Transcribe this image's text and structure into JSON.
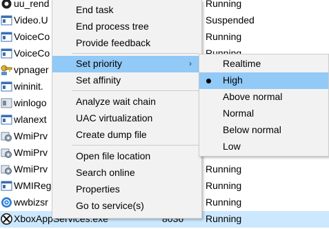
{
  "processes": [
    {
      "name": "uu_rend",
      "pid": "",
      "status": "Running",
      "icon": "app-window-icon"
    },
    {
      "name": "Video.U",
      "pid": "",
      "status": "Suspended",
      "icon": "app-window-icon"
    },
    {
      "name": "VoiceCo",
      "pid": "",
      "status": "Running",
      "icon": "app-window-icon"
    },
    {
      "name": "VoiceCo",
      "pid": "",
      "status": "Running",
      "icon": "app-window-icon"
    },
    {
      "name": "vpnager",
      "pid": "",
      "status": "",
      "icon": "key-icon"
    },
    {
      "name": "wininit.",
      "pid": "",
      "status": "",
      "icon": "app-window-icon"
    },
    {
      "name": "winlogo",
      "pid": "",
      "status": "",
      "icon": "app-window-icon"
    },
    {
      "name": "wlanext",
      "pid": "",
      "status": "",
      "icon": "app-window-icon"
    },
    {
      "name": "WmiPrv",
      "pid": "",
      "status": "",
      "icon": "gear-icon"
    },
    {
      "name": "WmiPrv",
      "pid": "",
      "status": "",
      "icon": "gear-icon"
    },
    {
      "name": "WmiPrv",
      "pid": "",
      "status": "Running",
      "icon": "gear-icon"
    },
    {
      "name": "WMIReg",
      "pid": "",
      "status": "Running",
      "icon": "app-window-icon"
    },
    {
      "name": "wwbizsr",
      "pid": "",
      "status": "Running",
      "icon": "globe-icon"
    },
    {
      "name": "XboxAppServices.exe",
      "pid": "8036",
      "status": "Running",
      "icon": "xbox-icon"
    }
  ],
  "context_menu": {
    "items": [
      {
        "label": "End task"
      },
      {
        "label": "End process tree"
      },
      {
        "label": "Provide feedback"
      },
      {
        "label": "Set priority",
        "submenu": true
      },
      {
        "label": "Set affinity"
      },
      {
        "label": "Analyze wait chain"
      },
      {
        "label": "UAC virtualization"
      },
      {
        "label": "Create dump file"
      },
      {
        "label": "Open file location"
      },
      {
        "label": "Search online"
      },
      {
        "label": "Properties"
      },
      {
        "label": "Go to service(s)"
      }
    ]
  },
  "priority_menu": {
    "items": [
      {
        "label": "Realtime"
      },
      {
        "label": "High",
        "selected": true
      },
      {
        "label": "Above normal"
      },
      {
        "label": "Normal"
      },
      {
        "label": "Below normal"
      },
      {
        "label": "Low"
      }
    ]
  },
  "colors": {
    "selected_row": "#cce8ff",
    "menu_highlight": "#91c9f7",
    "menu_background": "#f2f2f2"
  }
}
